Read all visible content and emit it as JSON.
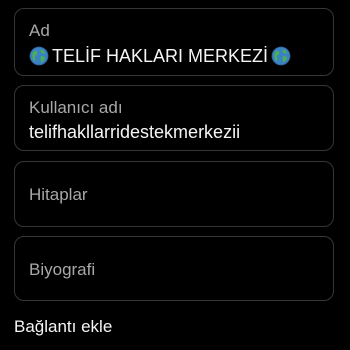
{
  "profile_form": {
    "name": {
      "label": "Ad",
      "value": "TELİF HAKLARI MERKEZİ",
      "prefix_icon": "globe-icon",
      "suffix_icon": "globe-icon"
    },
    "username": {
      "label": "Kullanıcı adı",
      "value": "telifhakllarridestekmerkezii"
    },
    "pronouns": {
      "label": "Hitaplar"
    },
    "bio": {
      "label": "Biyografi"
    },
    "add_link": {
      "label": "Bağlantı ekle"
    }
  },
  "colors": {
    "background": "#000000",
    "field_border": "#363636",
    "label_text": "#a8a8a8",
    "value_text": "#f5f5f5",
    "globe_ocean": "#3b82c4",
    "globe_land": "#4caf50"
  }
}
